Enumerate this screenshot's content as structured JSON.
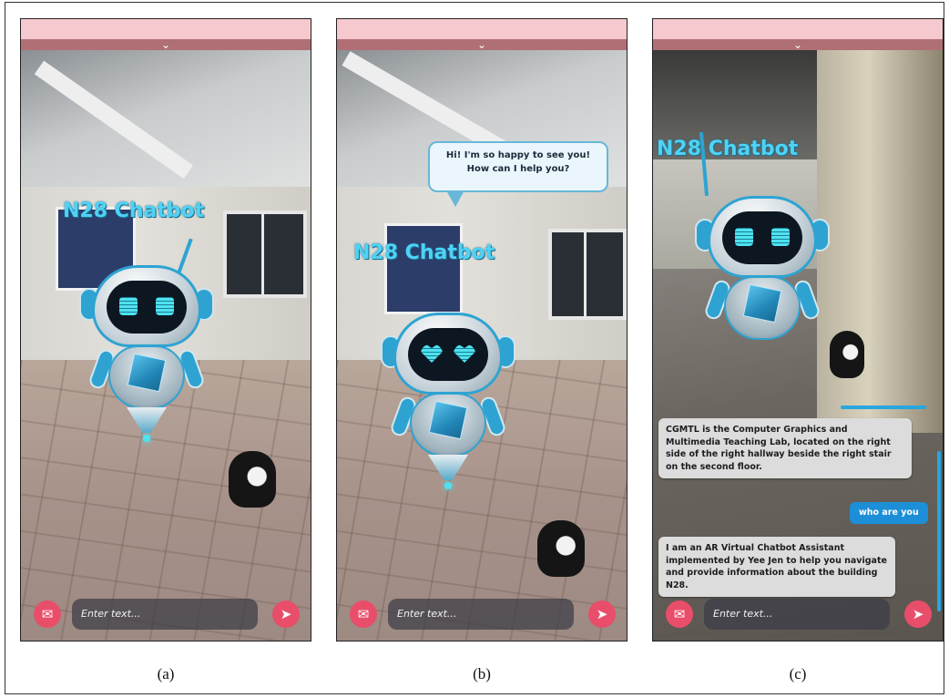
{
  "panels": {
    "a": {
      "bot_title": "N28 Chatbot",
      "input_placeholder": "Enter text...",
      "caption": "(a)"
    },
    "b": {
      "bot_title": "N28 Chatbot",
      "speech_bubble": "Hi! I'm so happy to see you!\nHow can I help you?",
      "input_placeholder": "Enter text...",
      "caption": "(b)"
    },
    "c": {
      "bot_title": "N28 Chatbot",
      "messages": [
        {
          "sender": "bot",
          "text": "CGMTL is the Computer Graphics and Multimedia Teaching Lab, located on the right side of the right hallway beside the right stair on the second floor."
        },
        {
          "sender": "user",
          "text": "who are you"
        },
        {
          "sender": "bot",
          "text": "I am an AR Virtual Chatbot Assistant implemented by Yee Jen to help you navigate and provide information about the building N28."
        }
      ],
      "input_placeholder": "Enter text...",
      "caption": "(c)"
    }
  },
  "icons": {
    "collapse": "chevron-down-icon",
    "chat": "chat-bubble-icon",
    "send": "send-arrow-icon"
  },
  "colors": {
    "topbar": "#f5c9cd",
    "accent_pink": "#e84e6a",
    "user_bubble": "#1d8fd8",
    "bot_title": "#4fd2f5"
  }
}
